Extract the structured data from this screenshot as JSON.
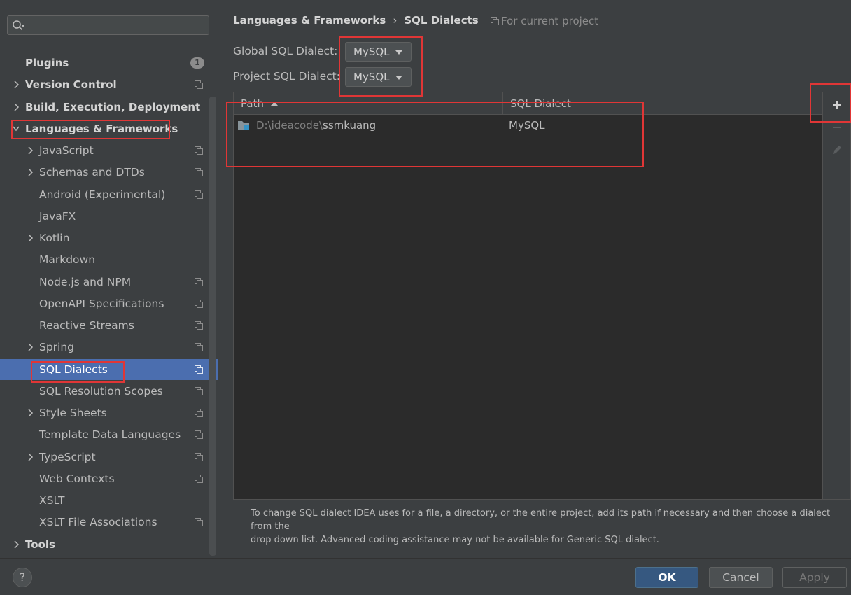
{
  "sidebar": {
    "search": {
      "value": "",
      "placeholder": ""
    },
    "items": [
      {
        "label": "Plugins",
        "bold": true,
        "arrow": false,
        "indent": 0,
        "badge": "1"
      },
      {
        "label": "Version Control",
        "bold": true,
        "arrow": "right",
        "indent": 0,
        "proj": true
      },
      {
        "label": "Build, Execution, Deployment",
        "bold": true,
        "arrow": "right",
        "indent": 0
      },
      {
        "label": "Languages & Frameworks",
        "bold": true,
        "arrow": "down",
        "indent": 0
      },
      {
        "label": "JavaScript",
        "arrow": "right",
        "indent": 1,
        "proj": true
      },
      {
        "label": "Schemas and DTDs",
        "arrow": "right",
        "indent": 1,
        "proj": true
      },
      {
        "label": "Android (Experimental)",
        "indent": 1,
        "proj": true
      },
      {
        "label": "JavaFX",
        "indent": 1
      },
      {
        "label": "Kotlin",
        "arrow": "right",
        "indent": 1
      },
      {
        "label": "Markdown",
        "indent": 1
      },
      {
        "label": "Node.js and NPM",
        "indent": 1,
        "proj": true
      },
      {
        "label": "OpenAPI Specifications",
        "indent": 1,
        "proj": true
      },
      {
        "label": "Reactive Streams",
        "indent": 1,
        "proj": true
      },
      {
        "label": "Spring",
        "arrow": "right",
        "indent": 1,
        "proj": true
      },
      {
        "label": "SQL Dialects",
        "indent": 1,
        "proj": true,
        "selected": true
      },
      {
        "label": "SQL Resolution Scopes",
        "indent": 1,
        "proj": true
      },
      {
        "label": "Style Sheets",
        "arrow": "right",
        "indent": 1,
        "proj": true
      },
      {
        "label": "Template Data Languages",
        "indent": 1,
        "proj": true
      },
      {
        "label": "TypeScript",
        "arrow": "right",
        "indent": 1,
        "proj": true
      },
      {
        "label": "Web Contexts",
        "indent": 1,
        "proj": true
      },
      {
        "label": "XSLT",
        "indent": 1
      },
      {
        "label": "XSLT File Associations",
        "indent": 1,
        "proj": true
      },
      {
        "label": "Tools",
        "bold": true,
        "arrow": "right",
        "indent": 0
      }
    ]
  },
  "content": {
    "breadcrumb": {
      "parent": "Languages & Frameworks",
      "separator": "›",
      "current": "SQL Dialects"
    },
    "scope_note": "For current project",
    "global_label": "Global SQL Dialect:",
    "global_value": "MySQL",
    "project_label": "Project SQL Dialect:",
    "project_value": "MySQL",
    "table": {
      "columns": [
        "Path",
        "SQL Dialect"
      ],
      "rows": [
        {
          "path_prefix": "D:\\ideacode\\",
          "path_name": "ssmkuang",
          "dialect": "MySQL"
        }
      ]
    },
    "hint_line1": "To change SQL dialect IDEA uses for a file, a directory, or the entire project, add its path if necessary and then choose a dialect from the",
    "hint_line2": "drop down list. Advanced coding assistance may not be available for Generic SQL dialect."
  },
  "footer": {
    "help_label": "?",
    "ok_label": "OK",
    "cancel_label": "Cancel",
    "apply_label": "Apply"
  },
  "colors": {
    "background": "#3c3f41",
    "selection": "#4b6eaf",
    "annotation": "#e03636",
    "ok_button": "#365880"
  }
}
